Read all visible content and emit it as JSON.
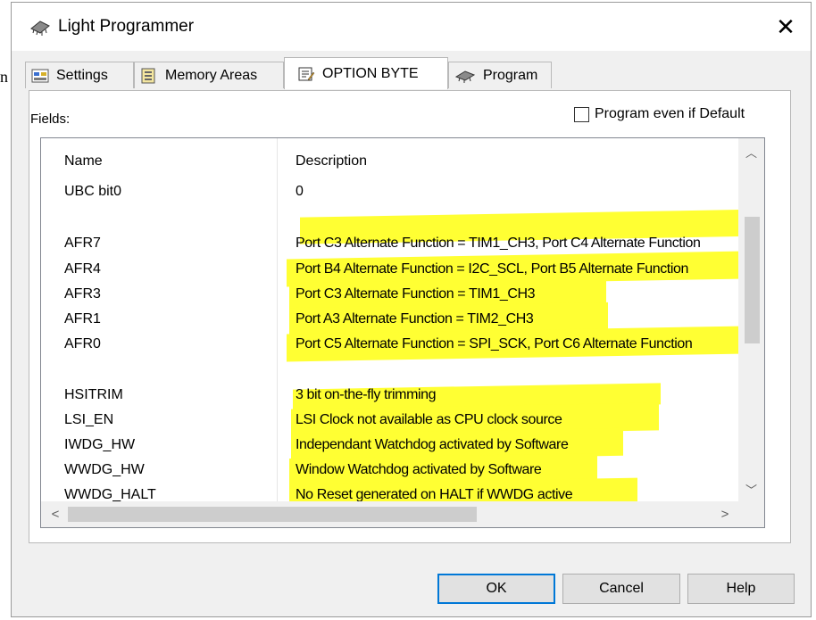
{
  "background": {
    "edge_letter": "n"
  },
  "window": {
    "title": "Light Programmer",
    "close_glyph": "✕"
  },
  "tabs": [
    {
      "label": "Settings",
      "icon": "settings-icon"
    },
    {
      "label": "Memory Areas",
      "icon": "memory-areas-icon"
    },
    {
      "label": "OPTION BYTE",
      "icon": "option-byte-icon",
      "active": true
    },
    {
      "label": "Program",
      "icon": "chip-icon"
    }
  ],
  "fields_label": "Fields:",
  "program_default": {
    "label": "Program even if Default",
    "checked": false
  },
  "columns": {
    "name": "Name",
    "description": "Description"
  },
  "rows": [
    {
      "name": "UBC bit0",
      "description": "0"
    },
    {
      "name": "",
      "description": ""
    },
    {
      "name": "AFR7",
      "description": "Port C3 Alternate Function = TIM1_CH3, Port C4 Alternate Function"
    },
    {
      "name": "AFR4",
      "description": "Port B4 Alternate Function = I2C_SCL, Port B5 Alternate Function"
    },
    {
      "name": "AFR3",
      "description": "Port C3 Alternate Function = TIM1_CH3"
    },
    {
      "name": "AFR1",
      "description": "Port A3 Alternate Function = TIM2_CH3"
    },
    {
      "name": "AFR0",
      "description": "Port C5 Alternate Function = SPI_SCK, Port C6 Alternate Function"
    },
    {
      "name": "",
      "description": ""
    },
    {
      "name": "HSITRIM",
      "description": "3 bit on-the-fly trimming"
    },
    {
      "name": "LSI_EN",
      "description": "LSI Clock not available as CPU clock source"
    },
    {
      "name": "IWDG_HW",
      "description": "Independant Watchdog activated by Software"
    },
    {
      "name": "WWDG_HW",
      "description": "Window Watchdog activated by Software"
    },
    {
      "name": "WWDG_HALT",
      "description": "No Reset generated on HALT if WWDG active"
    }
  ],
  "highlight_color": "#ffff33",
  "scroll_glyphs": {
    "up": "︿",
    "down": "﹀",
    "left": "<",
    "right": ">"
  },
  "buttons": {
    "ok": "OK",
    "cancel": "Cancel",
    "help": "Help"
  }
}
